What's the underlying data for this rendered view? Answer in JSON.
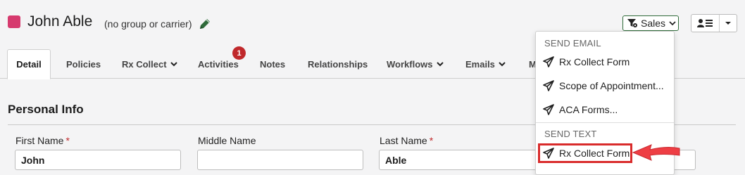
{
  "contact": {
    "name": "John Able",
    "subtitle": "(no group or carrier)",
    "color": "#d63a6e"
  },
  "toolbar": {
    "sales_label": "Sales",
    "sales_icon": "filter-gear-icon",
    "user_icon": "user-list-icon"
  },
  "tabs": [
    {
      "label": "Detail",
      "active": true
    },
    {
      "label": "Policies"
    },
    {
      "label": "Rx Collect",
      "dropdown": true
    },
    {
      "label": "Activities",
      "badge": "1"
    },
    {
      "label": "Notes"
    },
    {
      "label": "Relationships"
    },
    {
      "label": "Workflows",
      "dropdown": true
    },
    {
      "label": "Emails",
      "dropdown": true
    },
    {
      "label": "M"
    }
  ],
  "section": {
    "title": "Personal Info"
  },
  "fields": {
    "first_name": {
      "label": "First Name",
      "value": "John",
      "required": true
    },
    "middle_name": {
      "label": "Middle Name",
      "value": ""
    },
    "last_name": {
      "label": "Last Name",
      "value": "Able",
      "required": true
    }
  },
  "dropdown": {
    "send_email_header": "SEND EMAIL",
    "email_items": [
      "Rx Collect Form",
      "Scope of Appointment...",
      "ACA Forms..."
    ],
    "send_text_header": "SEND TEXT",
    "text_items": [
      "Rx Collect Form"
    ]
  },
  "colors": {
    "accent_red": "#d92b2b",
    "badge_red": "#c0282b",
    "sales_border": "#2f6b3a"
  }
}
